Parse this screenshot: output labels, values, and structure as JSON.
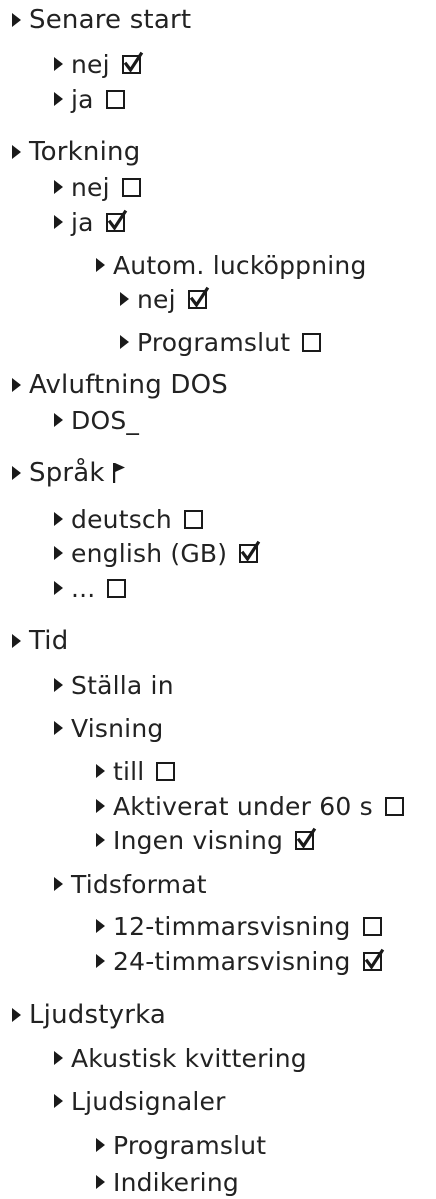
{
  "checked_color": "#1a1a1a",
  "menu": [
    {
      "label": "Senare start",
      "level": 0
    },
    {
      "label": "nej",
      "level": 1,
      "box": "checked"
    },
    {
      "label": "ja",
      "level": 1,
      "box": "unchecked"
    },
    {
      "label": "Torkning",
      "level": 0
    },
    {
      "label": "nej",
      "level": 1,
      "box": "unchecked"
    },
    {
      "label": "ja",
      "level": 1,
      "box": "checked"
    },
    {
      "label": "Autom. lucköppning",
      "level": 2
    },
    {
      "label": "nej",
      "level": 3,
      "box": "checked"
    },
    {
      "label": "Programslut",
      "level": 3,
      "box": "unchecked"
    },
    {
      "label": "Avluftning DOS",
      "level": 0
    },
    {
      "label": "DOS_",
      "level": 1
    },
    {
      "label": "Språk",
      "level": 0,
      "icon": "flag-icon"
    },
    {
      "label": "deutsch",
      "level": 1,
      "box": "unchecked"
    },
    {
      "label": "english (GB)",
      "level": 1,
      "box": "checked"
    },
    {
      "label": "...",
      "level": 1,
      "box": "unchecked"
    },
    {
      "label": "Tid",
      "level": 0
    },
    {
      "label": "Ställa in",
      "level": 1
    },
    {
      "label": "Visning",
      "level": 1
    },
    {
      "label": "till",
      "level": 2,
      "box": "unchecked"
    },
    {
      "label": "Aktiverat under 60 s",
      "level": 2,
      "box": "unchecked"
    },
    {
      "label": "Ingen visning",
      "level": 2,
      "box": "checked"
    },
    {
      "label": "Tidsformat",
      "level": 1
    },
    {
      "label": "12-timmarsvisning",
      "level": 2,
      "box": "unchecked"
    },
    {
      "label": "24-timmarsvisning",
      "level": 2,
      "box": "checked"
    },
    {
      "label": "Ljudstyrka",
      "level": 0
    },
    {
      "label": "Akustisk kvittering",
      "level": 1
    },
    {
      "label": "Ljudsignaler",
      "level": 1
    },
    {
      "label": "Programslut",
      "level": 2
    },
    {
      "label": "Indikering",
      "level": 2
    }
  ]
}
